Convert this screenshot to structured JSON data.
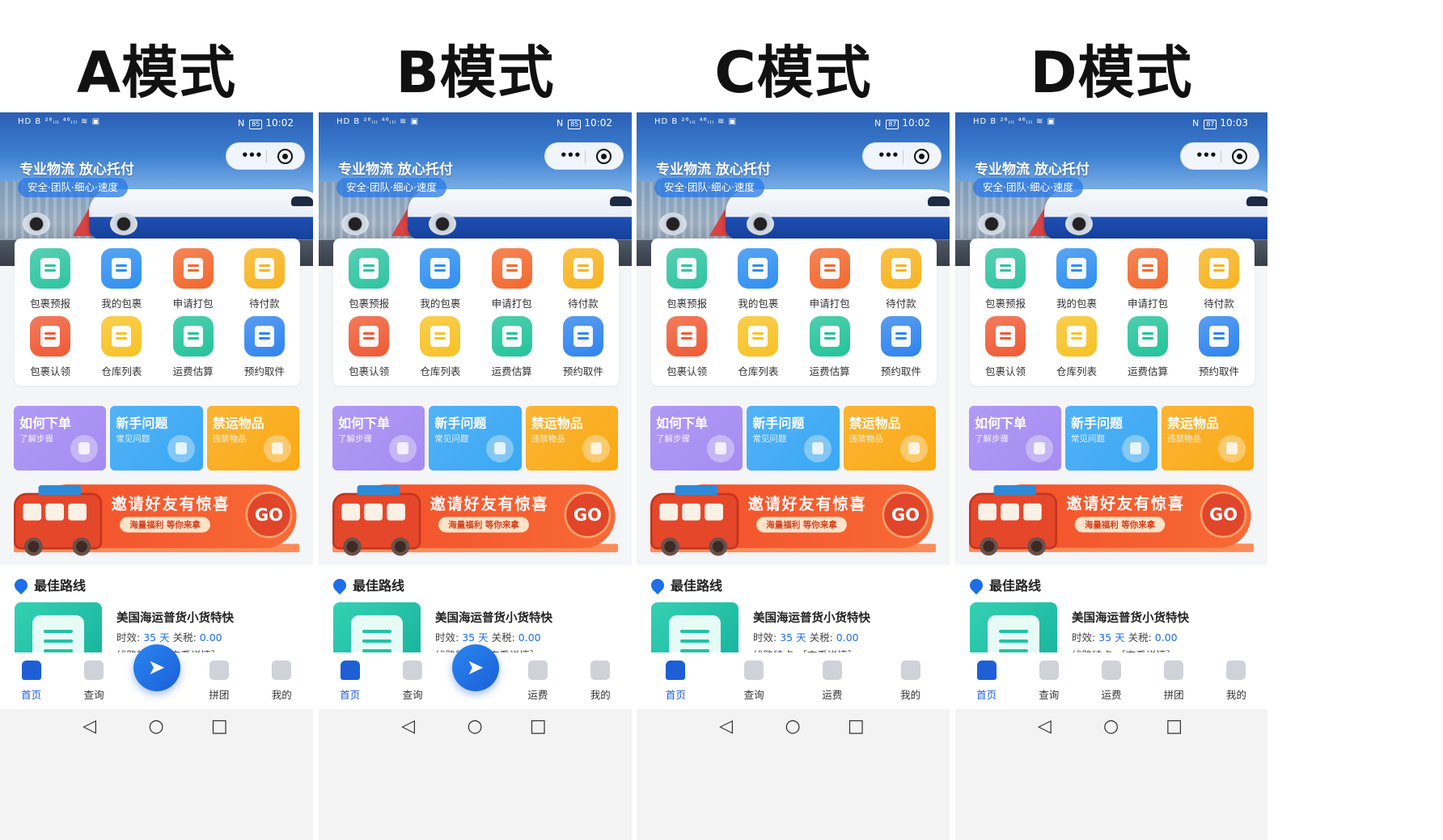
{
  "panels": [
    {
      "mode_title": "A模式",
      "status": {
        "left": "HD B ²⁶ᵢₗₗ ⁴⁶ᵢₗₗ ≋ ▣",
        "battery": "85",
        "time": "10:02"
      },
      "tabs": [
        {
          "label": "首页",
          "active": true
        },
        {
          "label": "查询",
          "active": false
        },
        {
          "label": "拼团",
          "active": false
        },
        {
          "label": "我的",
          "active": false
        }
      ],
      "has_fab": true
    },
    {
      "mode_title": "B模式",
      "status": {
        "left": "HD B ²⁶ᵢₗₗ ⁴⁶ᵢₗₗ ≋ ▣",
        "battery": "85",
        "time": "10:02"
      },
      "tabs": [
        {
          "label": "首页",
          "active": true
        },
        {
          "label": "查询",
          "active": false
        },
        {
          "label": "运费",
          "active": false
        },
        {
          "label": "我的",
          "active": false
        }
      ],
      "has_fab": true
    },
    {
      "mode_title": "C模式",
      "status": {
        "left": "HD B ²⁶ᵢₗₗ ⁴⁶ᵢₗₗ ≋ ▣",
        "battery": "87",
        "time": "10:02"
      },
      "tabs": [
        {
          "label": "首页",
          "active": true
        },
        {
          "label": "查询",
          "active": false
        },
        {
          "label": "运费",
          "active": false
        },
        {
          "label": "我的",
          "active": false
        }
      ],
      "has_fab": false
    },
    {
      "mode_title": "D模式",
      "status": {
        "left": "HD B ²⁶ᵢₗₗ ⁴⁶ᵢₗₗ ≋ ▣",
        "battery": "87",
        "time": "10:03"
      },
      "tabs": [
        {
          "label": "首页",
          "active": true
        },
        {
          "label": "查询",
          "active": false
        },
        {
          "label": "运费",
          "active": false
        },
        {
          "label": "拼团",
          "active": false
        },
        {
          "label": "我的",
          "active": false
        }
      ],
      "has_fab": false
    }
  ],
  "hero": {
    "slogan": "专业物流 放心托付",
    "tagline": "安全·团队·细心·速度"
  },
  "grid_items": [
    {
      "label": "包裹预报",
      "icon": "parcel-forecast-icon",
      "color": "#2ec4a0"
    },
    {
      "label": "我的包裹",
      "icon": "my-parcel-icon",
      "color": "#2f8ff0"
    },
    {
      "label": "申请打包",
      "icon": "gift-pack-icon",
      "color": "#f2682e"
    },
    {
      "label": "待付款",
      "icon": "wallet-icon",
      "color": "#f8b31f"
    },
    {
      "label": "包裹认领",
      "icon": "claim-icon",
      "color": "#ef5a34"
    },
    {
      "label": "仓库列表",
      "icon": "warehouse-icon",
      "color": "#f8c224"
    },
    {
      "label": "运费估算",
      "icon": "calculator-icon",
      "color": "#23c39a"
    },
    {
      "label": "预约取件",
      "icon": "pickup-icon",
      "color": "#2f84ee"
    }
  ],
  "info_cards": [
    {
      "title": "如何下单",
      "sub": "了解步骤",
      "color": "#a68cf3"
    },
    {
      "title": "新手问题",
      "sub": "常见问题",
      "color": "#3aa8f5"
    },
    {
      "title": "禁运物品",
      "sub": "违禁物品",
      "color": "#fbaa16"
    }
  ],
  "invite": {
    "title": "邀请好友有惊喜",
    "sub": "海量福利 等你来拿",
    "go": "GO"
  },
  "route": {
    "section_title": "最佳路线",
    "title": "美国海运普货小货特快",
    "time_label": "时效:",
    "time_value": "35 天",
    "tax_label": "关税:",
    "tax_value": "0.00",
    "feature": "线路特点:［查看详情］"
  },
  "nav": {
    "back": "◁",
    "home": "○",
    "recent": "□"
  },
  "colors": {
    "primary": "#1e5fd6",
    "accent_orange": "#f24f2a"
  }
}
